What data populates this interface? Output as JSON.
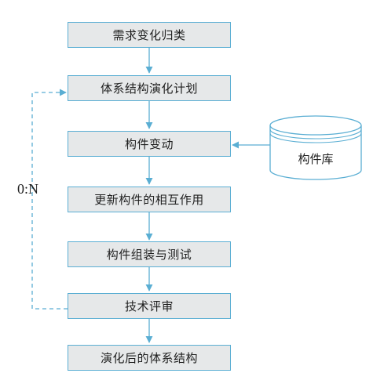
{
  "steps": [
    "需求变化归类",
    "体系结构演化计划",
    "构件变动",
    "更新构件的相互作用",
    "构件组装与测试",
    "技术评审",
    "演化后的体系结构"
  ],
  "database": {
    "label": "构件库"
  },
  "loop": {
    "label": "0:N"
  },
  "colors": {
    "box_fill": "#e6e8e9",
    "border": "#5aaed3",
    "text": "#1f1f1f"
  }
}
